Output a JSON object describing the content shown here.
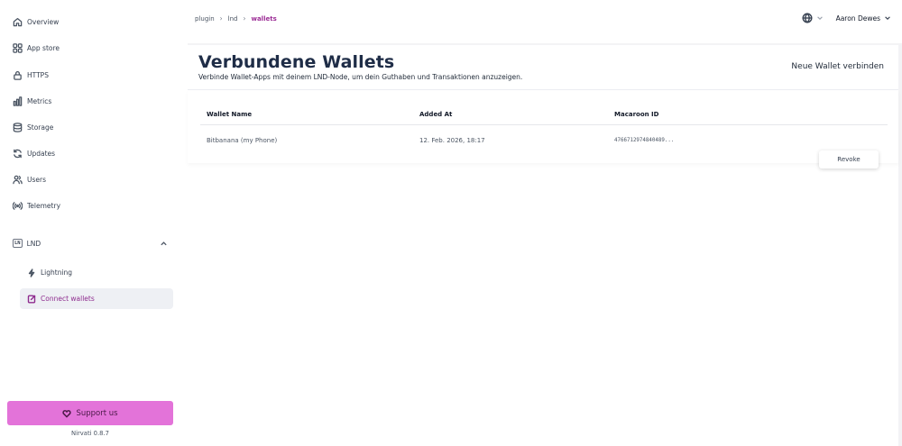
{
  "sidebar": {
    "items": [
      {
        "label": "Overview",
        "icon": "home-icon"
      },
      {
        "label": "App store",
        "icon": "grid-icon"
      },
      {
        "label": "HTTPS",
        "icon": "lock-icon"
      },
      {
        "label": "Metrics",
        "icon": "bar-chart-icon"
      },
      {
        "label": "Storage",
        "icon": "database-icon"
      },
      {
        "label": "Updates",
        "icon": "refresh-icon"
      },
      {
        "label": "Users",
        "icon": "users-icon"
      },
      {
        "label": "Telemetry",
        "icon": "broadcast-icon"
      }
    ],
    "plugin": {
      "badge": "LN",
      "label": "LND",
      "expanded": true
    },
    "sub_items": [
      {
        "label": "Lightning",
        "icon": "lightning-icon",
        "active": false
      },
      {
        "label": "Connect wallets",
        "icon": "wallet-connect-icon",
        "active": true
      }
    ],
    "support_label": "Support us",
    "version": "Nirvati 0.8.7"
  },
  "breadcrumb": [
    "plugin",
    "lnd",
    "wallets"
  ],
  "topbar": {
    "user_name": "Aaron Dewes"
  },
  "page": {
    "title": "Verbundene Wallets",
    "subtitle": "Verbinde Wallet-Apps mit deinem LND-Node, um dein Guthaben und Transaktionen anzuzeigen.",
    "connect_label": "Neue Wallet verbinden"
  },
  "table": {
    "headers": [
      "Wallet Name",
      "Added At",
      "Macaroon ID"
    ],
    "rows": [
      {
        "name": "Bitbanana (my Phone)",
        "added_at": "12. Feb. 2026, 18:17",
        "macaroon_id": "4766712974840489...",
        "action": "Revoke"
      }
    ]
  },
  "colors": {
    "accent": "#9c2d96",
    "support_button": "#e373d9",
    "title": "#1f2d47"
  }
}
